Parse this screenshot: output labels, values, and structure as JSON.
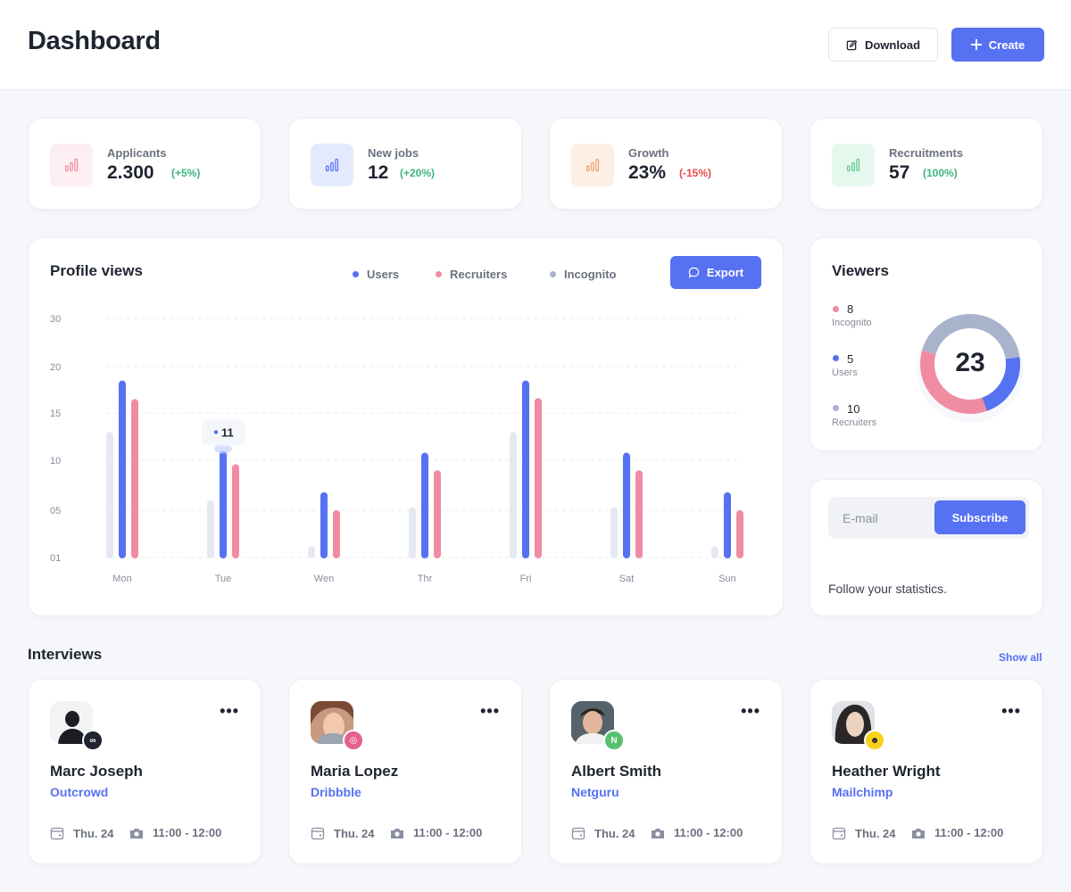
{
  "header": {
    "title": "Dashboard",
    "download_label": "Download",
    "create_label": "Create"
  },
  "stats": [
    {
      "label": "Applicants",
      "value": "2.300",
      "change": "(+5%)",
      "change_color": "#3fb37f",
      "icon_bg": "#fdeef1",
      "icon_color": "#f08ca2",
      "icon": "bar-chart-icon"
    },
    {
      "label": "New jobs",
      "value": "12",
      "change": "(+20%)",
      "change_color": "#3fb37f",
      "icon_bg": "#e4eafd",
      "icon_color": "#5671f2",
      "icon": "bar-chart-icon"
    },
    {
      "label": "Growth",
      "value": "23%",
      "change": "(-15%)",
      "change_color": "#e5484d",
      "icon_bg": "#fdefe4",
      "icon_color": "#f2a06b",
      "icon": "bar-chart-icon"
    },
    {
      "label": "Recruitments",
      "value": "57",
      "change": "(100%)",
      "change_color": "#3fb37f",
      "icon_bg": "#e5f8ee",
      "icon_color": "#63c98c",
      "icon": "bar-chart-icon"
    }
  ],
  "profile_views": {
    "title": "Profile views",
    "export_label": "Export",
    "tooltip": "11",
    "legend": [
      {
        "name": "Users",
        "color": "#5671f2"
      },
      {
        "name": "Recruiters",
        "color": "#f08ca2"
      },
      {
        "name": "Incognito",
        "color": "#a9b4cc"
      }
    ]
  },
  "chart_data": {
    "type": "bar",
    "categories": [
      "Mon",
      "Tue",
      "Wen",
      "Thr",
      "Fri",
      "Sat",
      "Sun"
    ],
    "y_ticks": [
      "30",
      "20",
      "15",
      "10",
      "05",
      "01"
    ],
    "series": [
      {
        "name": "Incognito",
        "values": [
          13,
          6,
          1.2,
          5.3,
          13,
          5.3,
          1.2
        ],
        "color": "#e5e9f1"
      },
      {
        "name": "Users",
        "values": [
          18.5,
          11,
          6.8,
          10.8,
          18.5,
          10.8,
          6.8
        ],
        "color": "#5671f2"
      },
      {
        "name": "Recruiters",
        "values": [
          16.5,
          9.6,
          5,
          9,
          16.6,
          9,
          5
        ],
        "color": "#f08ca2"
      }
    ],
    "highlight": {
      "category": "Tue",
      "series": "Users",
      "value": 11
    }
  },
  "viewers": {
    "title": "Viewers",
    "total": "23",
    "items": [
      {
        "value": "8",
        "label": "Incognito",
        "color": "#f08ca2"
      },
      {
        "value": "5",
        "label": "Users",
        "color": "#5671f2"
      },
      {
        "value": "10",
        "label": "Recruiters",
        "color": "#a9b4cc"
      }
    ],
    "donut": [
      {
        "name": "Users",
        "value": 5,
        "color": "#5671f2"
      },
      {
        "name": "Recruiters",
        "value": 8,
        "color": "#f08ca2"
      },
      {
        "name": "Incognito",
        "value": 10,
        "color": "#a9b4cc"
      }
    ]
  },
  "subscribe": {
    "placeholder": "E-mail",
    "button_label": "Subscribe",
    "text": "Follow your statistics."
  },
  "interviews": {
    "title": "Interviews",
    "show_all": "Show all",
    "people": [
      {
        "name": "Marc Joseph",
        "company": "Outcrowd",
        "date": "Thu. 24",
        "time": "11:00 - 12:00",
        "badge_color": "#1f2430",
        "badge_icon": "outcrowd-logo-icon",
        "badge_text": "∞"
      },
      {
        "name": "Maria Lopez",
        "company": "Dribbble",
        "date": "Thu. 24",
        "time": "11:00 - 12:00",
        "badge_color": "#e4608f",
        "badge_icon": "dribbble-logo-icon",
        "badge_text": "◎"
      },
      {
        "name": "Albert Smith",
        "company": "Netguru",
        "date": "Thu. 24",
        "time": "11:00 - 12:00",
        "badge_color": "#57c16f",
        "badge_icon": "netguru-logo-icon",
        "badge_text": "N"
      },
      {
        "name": "Heather Wright",
        "company": "Mailchimp",
        "date": "Thu. 24",
        "time": "11:00 - 12:00",
        "badge_color": "#f7d21d",
        "badge_icon": "mailchimp-logo-icon",
        "badge_text": "☻"
      }
    ]
  }
}
